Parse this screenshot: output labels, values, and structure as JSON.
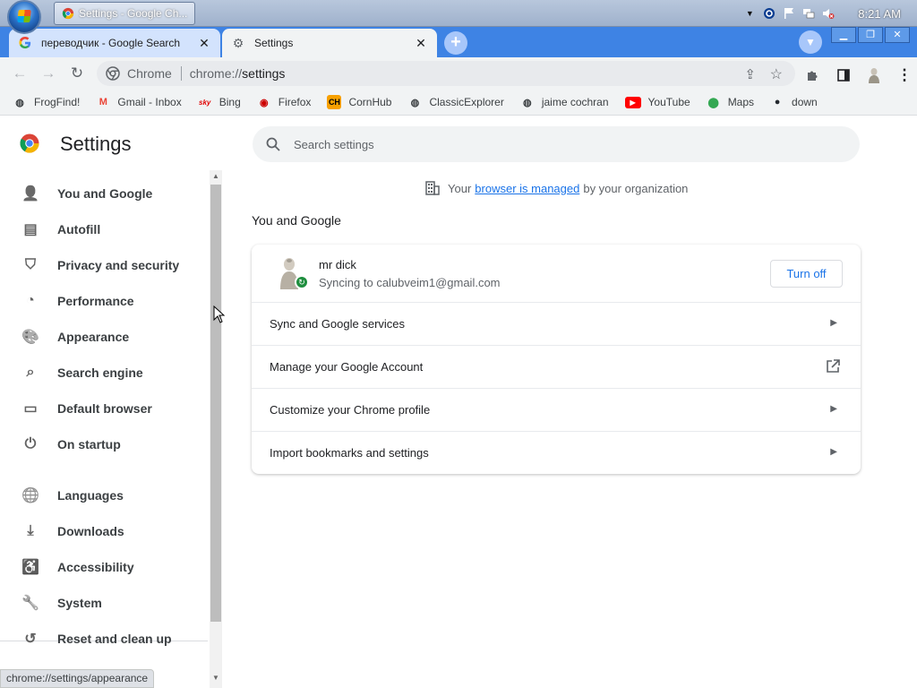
{
  "taskbar": {
    "window_button_label": "Settings - Google Ch...",
    "clock": "8:21 AM"
  },
  "tabs": [
    {
      "title": "переводчик - Google Search",
      "favicon": "google-g-icon",
      "active": false
    },
    {
      "title": "Settings",
      "favicon": "gear-icon",
      "active": true
    }
  ],
  "toolbar": {
    "chip_label": "Chrome",
    "url": "chrome://settings",
    "url_scheme": "chrome://",
    "url_host": "settings"
  },
  "bookmarks": [
    {
      "label": "FrogFind!",
      "icon": "globe-icon",
      "color": "#3c4043"
    },
    {
      "label": "Gmail - Inbox",
      "icon": "gmail-icon",
      "color": "#ea4335"
    },
    {
      "label": "Bing",
      "icon": "sky-icon",
      "color": "#e00000"
    },
    {
      "label": "Firefox",
      "icon": "firefox-icon",
      "color": "#cc0000"
    },
    {
      "label": "CornHub",
      "icon": "ch-icon",
      "color": "#f7a000"
    },
    {
      "label": "ClassicExplorer",
      "icon": "globe-icon",
      "color": "#3c4043"
    },
    {
      "label": "jaime cochran",
      "icon": "globe-icon",
      "color": "#3c4043"
    },
    {
      "label": "YouTube",
      "icon": "youtube-icon",
      "color": "#ff0000"
    },
    {
      "label": "Maps",
      "icon": "maps-pin-icon",
      "color": "#34a853"
    },
    {
      "label": "down",
      "icon": "github-icon",
      "color": "#24292f"
    }
  ],
  "settings": {
    "title": "Settings",
    "search_placeholder": "Search settings"
  },
  "nav": [
    {
      "label": "You and Google",
      "icon": "person-icon"
    },
    {
      "label": "Autofill",
      "icon": "clipboard-icon"
    },
    {
      "label": "Privacy and security",
      "icon": "shield-icon"
    },
    {
      "label": "Performance",
      "icon": "speedometer-icon"
    },
    {
      "label": "Appearance",
      "icon": "palette-icon"
    },
    {
      "label": "Search engine",
      "icon": "search-icon"
    },
    {
      "label": "Default browser",
      "icon": "browser-window-icon"
    },
    {
      "label": "On startup",
      "icon": "power-icon"
    },
    {
      "label": "Languages",
      "icon": "globe-icon"
    },
    {
      "label": "Downloads",
      "icon": "download-icon"
    },
    {
      "label": "Accessibility",
      "icon": "accessibility-icon"
    },
    {
      "label": "System",
      "icon": "wrench-icon"
    },
    {
      "label": "Reset and clean up",
      "icon": "history-icon"
    }
  ],
  "managed": {
    "prefix": "Your",
    "link": "browser is managed",
    "suffix": "by your organization"
  },
  "section": {
    "title": "You and Google"
  },
  "profile": {
    "name": "mr dick",
    "email": "Syncing to calubveim1@gmail.com",
    "turn_off_label": "Turn off"
  },
  "card_rows": [
    {
      "label": "Sync and Google services",
      "action": "arrow-right-icon"
    },
    {
      "label": "Manage your Google Account",
      "action": "open-external-icon"
    },
    {
      "label": "Customize your Chrome profile",
      "action": "arrow-right-icon"
    },
    {
      "label": "Import bookmarks and settings",
      "action": "arrow-right-icon"
    }
  ],
  "status_bar": {
    "url": "chrome://settings/appearance"
  },
  "colors": {
    "tabstrip": "#3e83e4",
    "link": "#1a73e8",
    "sync_green": "#1e8e3e"
  }
}
